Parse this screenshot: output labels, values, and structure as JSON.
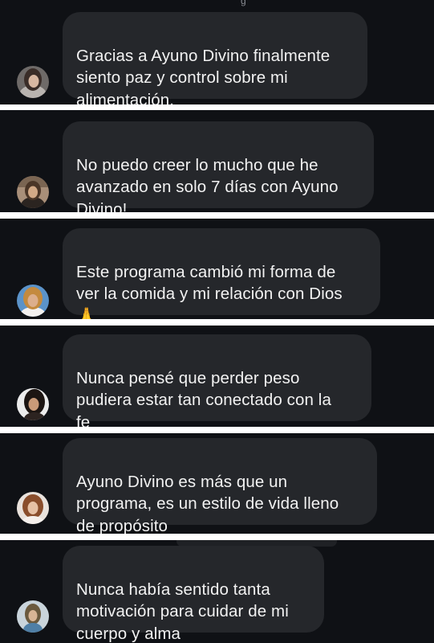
{
  "messages": [
    {
      "text": "Gracias a Ayuno Divino finalmente\nsiento paz y control sobre mi\nalimentación.",
      "avatar": "avatar-woman-1"
    },
    {
      "text": "No puedo creer lo mucho que he\navanzado en solo 7 días con Ayuno\nDivino!",
      "avatar": "avatar-woman-2"
    },
    {
      "text": "Este programa cambió mi forma de\nver la comida y mi relación con Dios\n🙏",
      "avatar": "avatar-woman-3"
    },
    {
      "text": "Nunca pensé que perder peso\npudiera estar tan conectado con la\nfe",
      "avatar": "avatar-woman-4"
    },
    {
      "text": "Ayuno Divino es más que un\nprograma, es un estilo de vida lleno\nde propósito",
      "avatar": "avatar-woman-5"
    },
    {
      "text": "Nunca había sentido tanta\nmotivación para cuidar de mi\ncuerpo y alma",
      "avatar": "avatar-woman-6"
    }
  ],
  "colors": {
    "panel_bg": "#0f1115",
    "bubble_bg": "#25272b",
    "text": "#f2f2f2",
    "divider": "#ffffff"
  }
}
